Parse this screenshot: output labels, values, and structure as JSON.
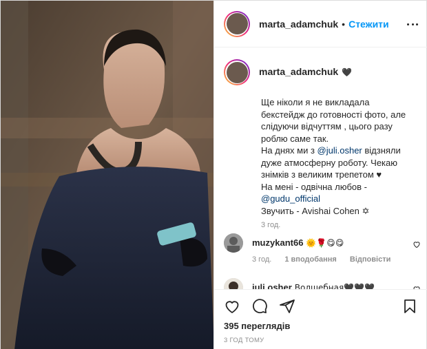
{
  "post": {
    "author": {
      "username": "marta_adamchuk",
      "follow_label": "Стежити",
      "separator": "•"
    },
    "caption": {
      "username": "marta_adamchuk",
      "heart": "🖤",
      "lines": [
        "Ще ніколи я не викладала",
        "бекстейдж до готовності фото, але",
        "слідуючи відчуттям , цього разу",
        "роблю саме так."
      ],
      "line5_prefix": "На днях ми з ",
      "mention1": "@juli.osher",
      "line5_suffix": " відзняли",
      "line6": "дуже атмосферну роботу. Чекаю",
      "line7": "знімків з великим трепетом ♥",
      "line8": "На мені - одвічна любов -",
      "mention2": "@gudu_official",
      "line10": "Звучить - Avishai Cohen ✡",
      "time": "3 год."
    },
    "comments": [
      {
        "username": "muzykant66",
        "text": "🌞🌹😋😋",
        "time": "3 год.",
        "likes": "1 вподобання",
        "reply_label": "Відповісти"
      },
      {
        "username": "juli.osher",
        "text": "Волшебная🖤🖤🖤"
      }
    ],
    "views": "395 переглядів",
    "posted_ago": "3 ГОД ТОМУ",
    "colors": {
      "link": "#0095f6",
      "mention": "#00376b",
      "meta": "#8e8e8e"
    }
  }
}
